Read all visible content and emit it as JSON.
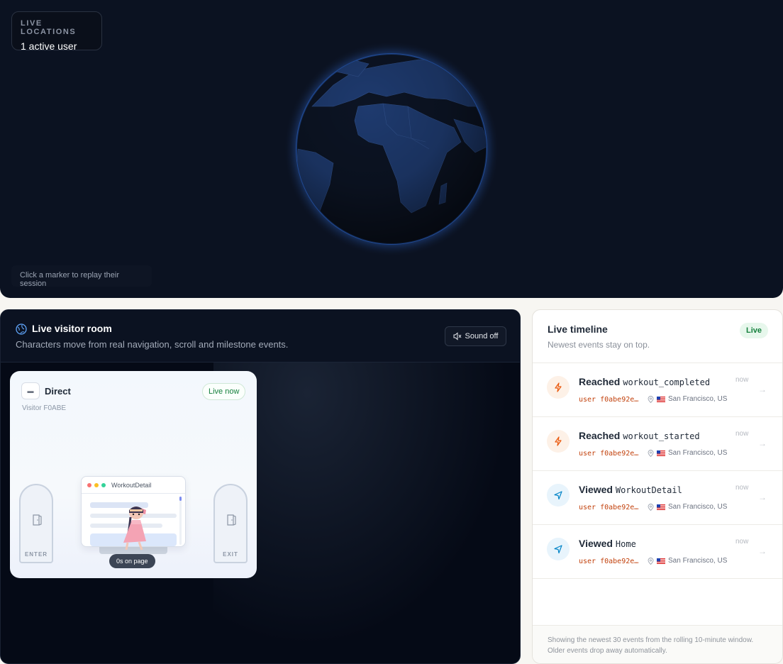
{
  "globe_panel": {
    "live_label": "LIVE LOCATIONS",
    "active_users": "1 active user",
    "hint": "Click a marker to replay their session"
  },
  "room": {
    "title": "Live visitor room",
    "subtitle": "Characters move from real navigation, scroll and milestone events.",
    "sound_label": "Sound off",
    "card": {
      "source": "Direct",
      "visitor": "Visitor F0ABE",
      "live_label": "Live now",
      "enter_label": "ENTER",
      "exit_label": "EXIT",
      "page_title": "WorkoutDetail",
      "time_on_page": "0s on page"
    }
  },
  "timeline": {
    "title": "Live timeline",
    "subtitle": "Newest events stay on top.",
    "live_badge": "Live",
    "events": [
      {
        "verb": "Reached",
        "target": "workout_completed",
        "user": "user f0abe92e…",
        "location": "San Francisco, US",
        "time": "now",
        "icon": "zap-icon"
      },
      {
        "verb": "Reached",
        "target": "workout_started",
        "user": "user f0abe92e…",
        "location": "San Francisco, US",
        "time": "now",
        "icon": "zap-icon"
      },
      {
        "verb": "Viewed",
        "target": "WorkoutDetail",
        "user": "user f0abe92e…",
        "location": "San Francisco, US",
        "time": "now",
        "icon": "navigation-icon"
      },
      {
        "verb": "Viewed",
        "target": "Home",
        "user": "user f0abe92e…",
        "location": "San Francisco, US",
        "time": "now",
        "icon": "navigation-icon"
      }
    ],
    "footer_line1": "Showing the newest 30 events from the rolling 10-minute window.",
    "footer_line2": "Older events drop away automatically."
  },
  "colors": {
    "globe_bg": "#0b1221",
    "ocean": "#0c1424",
    "land": "#1e3a6e",
    "zap_bg": "#fdf1e7",
    "zap": "#ea580c",
    "nav_bg": "#e8f4fc",
    "nav": "#0284c7",
    "accent_green": "#15803d"
  }
}
